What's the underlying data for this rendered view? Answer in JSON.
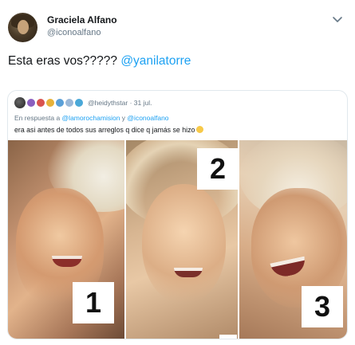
{
  "tweet": {
    "author_name": "Graciela Alfano",
    "author_handle": "@iconoalfano",
    "text_prefix": "Esta eras vos????? ",
    "text_mention": "@yanilatorre"
  },
  "quoted": {
    "handle_date": "@heidythstar · 31 jul.",
    "reply_prefix": "En respuesta a ",
    "reply_mention_1": "@lamorochamision",
    "reply_joiner": " y ",
    "reply_mention_2": "@iconoalfano",
    "text": "era asi antes de todos sus arreglos q dice q jamás se hizo",
    "photo_labels": [
      "1",
      "2",
      "3"
    ]
  },
  "colors": {
    "link": "#1da1f2",
    "secondary_text": "#657786",
    "primary_text": "#14171a",
    "border": "#e1e8ed"
  },
  "icons": {
    "menu": "chevron-down-icon",
    "emoji": "thinking-face-emoji"
  }
}
